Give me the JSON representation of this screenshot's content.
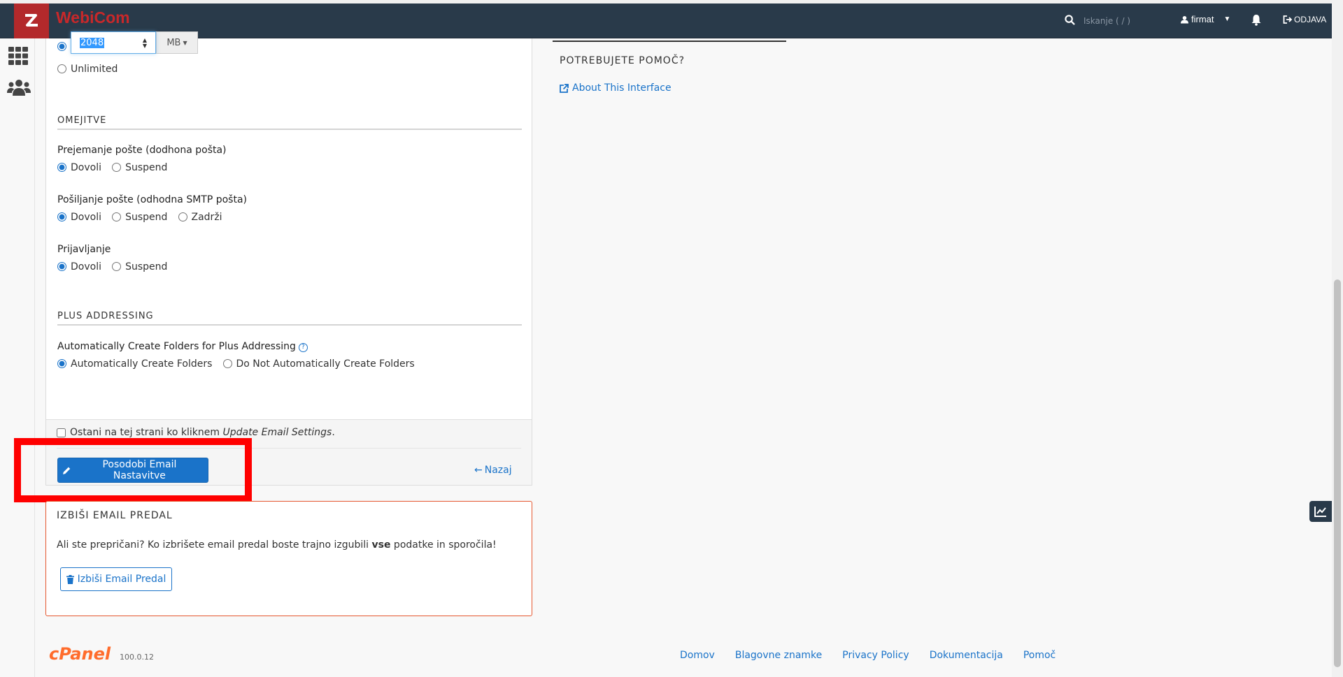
{
  "brand": {
    "name": "WebiCom",
    "logo_icon": "webicom-logo"
  },
  "topbar": {
    "search_placeholder": "Iskanje ( / )",
    "username": "firmat",
    "logout_label": "ODJAVA"
  },
  "quota": {
    "value": "2048",
    "unit": "MB",
    "unlimited_label": "Unlimited"
  },
  "restrictions": {
    "heading": "OMEJITVE",
    "receiving": {
      "label": "Prejemanje pošte (dodhona pošta)",
      "options": [
        "Dovoli",
        "Suspend"
      ],
      "selected": "Dovoli"
    },
    "sending": {
      "label": "Pošiljanje pošte (odhodna SMTP pošta)",
      "options": [
        "Dovoli",
        "Suspend",
        "Zadrži"
      ],
      "selected": "Dovoli"
    },
    "login": {
      "label": "Prijavljanje",
      "options": [
        "Dovoli",
        "Suspend"
      ],
      "selected": "Dovoli"
    }
  },
  "plus_addressing": {
    "heading": "PLUS ADDRESSING",
    "label": "Automatically Create Folders for Plus Addressing",
    "options": [
      "Automatically Create Folders",
      "Do Not Automatically Create Folders"
    ],
    "selected": "Automatically Create Folders"
  },
  "form_footer": {
    "stay_prefix": "Ostani na tej strani ko kliknem ",
    "stay_emph": "Update Email Settings",
    "stay_suffix": ".",
    "update_button": "Posodobi Email Nastavitve",
    "back_link": "Nazaj"
  },
  "delete": {
    "heading": "IZBIŠI EMAIL PREDAL",
    "text_prefix": "Ali ste prepričani? Ko izbrišete email predal boste trajno izgubili ",
    "text_bold": "vse",
    "text_suffix": " podatke in sporočila!",
    "button": "Izbiši Email Predal"
  },
  "help": {
    "heading": "POTREBUJETE POMOČ?",
    "about_link": "About This Interface"
  },
  "footer": {
    "logo": "cPanel",
    "version": "100.0.12",
    "links": [
      "Domov",
      "Blagovne znamke",
      "Privacy Policy",
      "Dokumentacija",
      "Pomoč"
    ]
  },
  "colors": {
    "topbar": "#293a4a",
    "brand_red": "#c8282a",
    "accent": "#1a73c9",
    "danger_border": "#e5572f",
    "highlight": "#ff0000"
  }
}
